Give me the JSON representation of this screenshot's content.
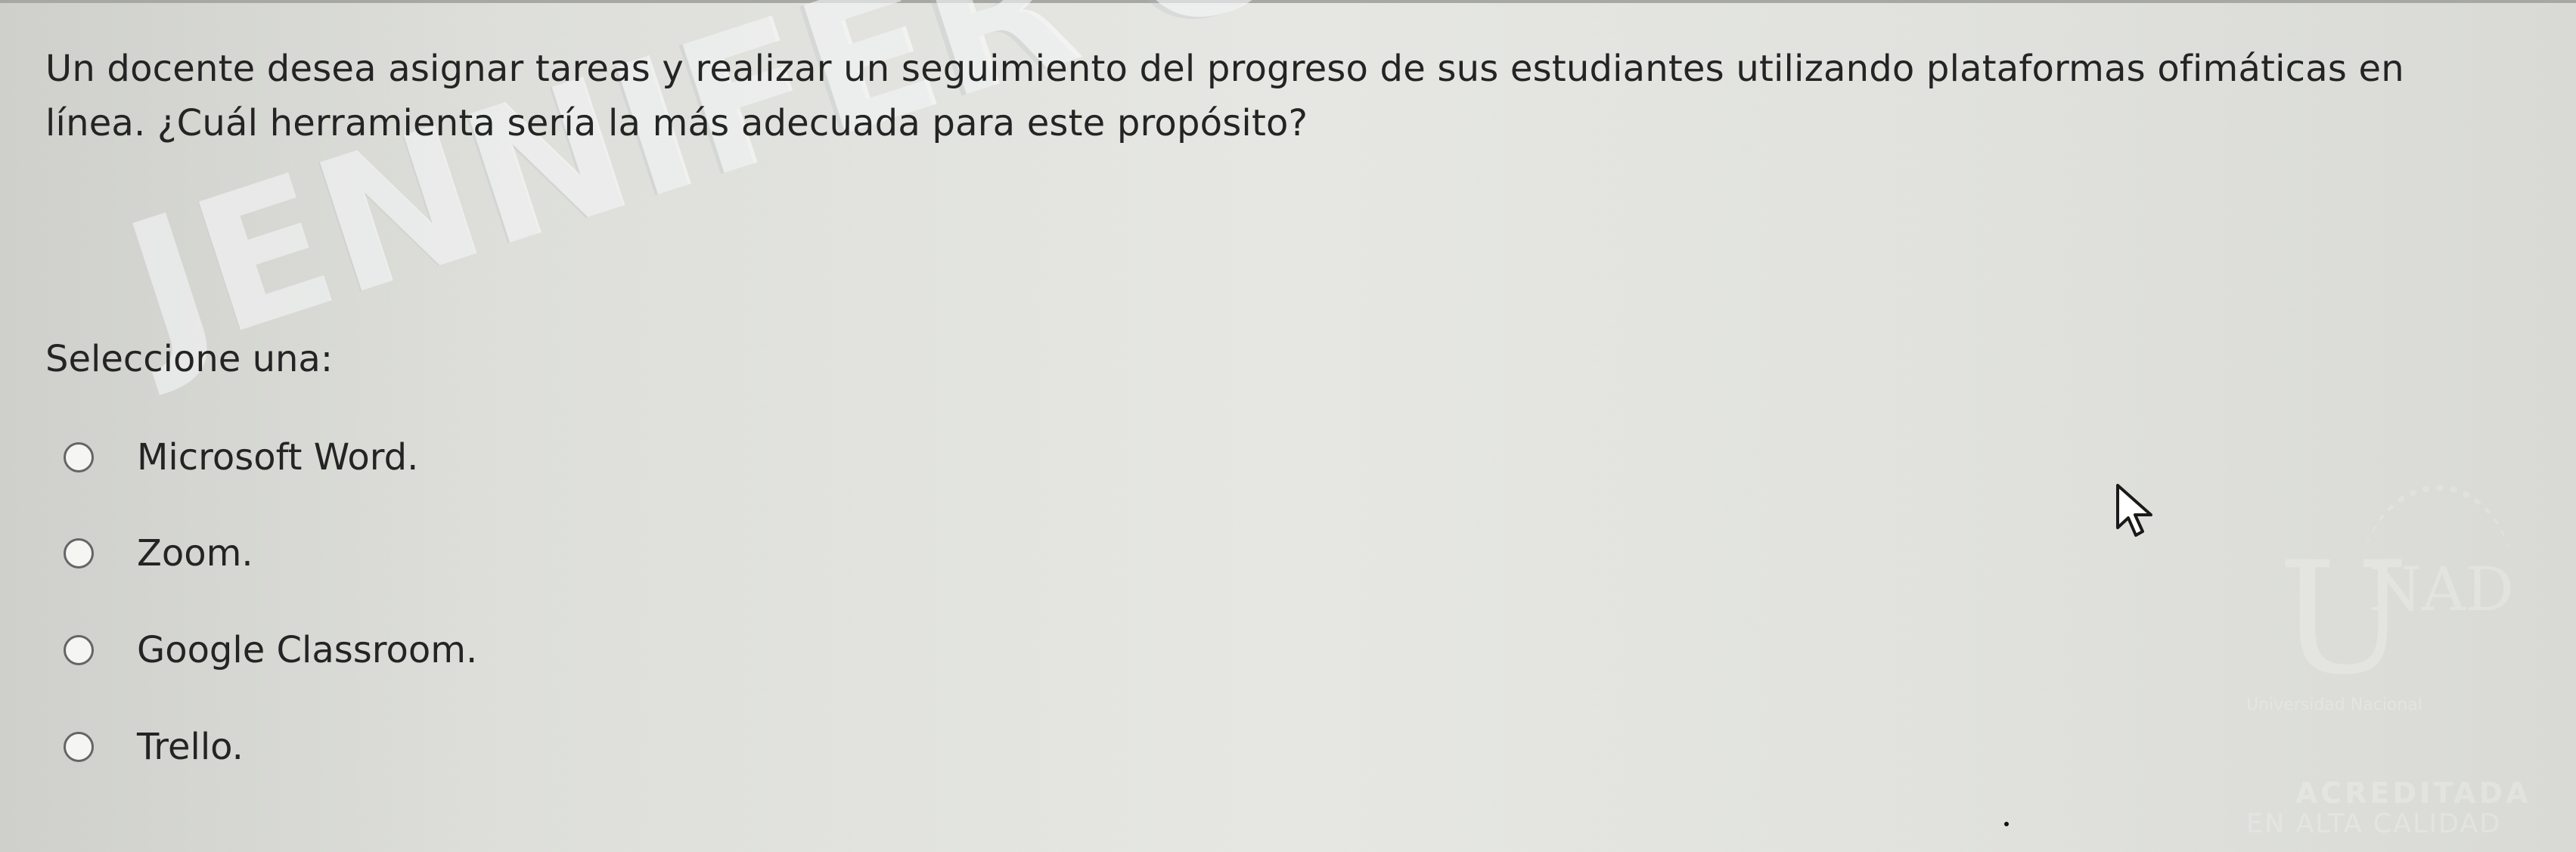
{
  "question": {
    "line1": "Un docente desea asignar tareas y realizar un seguimiento del progreso de sus estudiantes utilizando plataformas ofimáticas en",
    "line2": "línea. ¿Cuál herramienta sería la más adecuada para este propósito?"
  },
  "prompt": "Seleccione una:",
  "options": [
    "Microsoft Word.",
    "Zoom.",
    "Google Classroom.",
    "Trello."
  ],
  "watermark": "JENNIFER CORDERO BEDOYA",
  "institution_watermark": {
    "brand": "UNAD",
    "subtitle": "Universidad Nacional",
    "accreditation": "ACREDITADA",
    "quality": "EN ALTA CALIDAD"
  },
  "colors": {
    "background": "#e1e2de",
    "text": "#242424",
    "radio_border": "#656565"
  }
}
